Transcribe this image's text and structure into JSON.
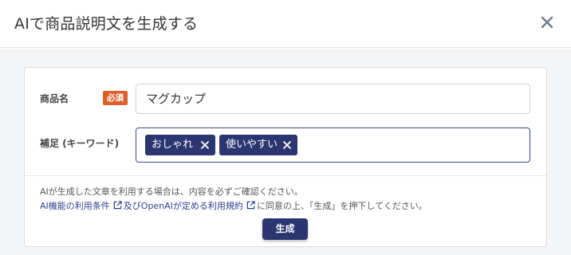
{
  "modal": {
    "title": "AIで商品説明文を生成する",
    "close_icon": "close-icon"
  },
  "form": {
    "product_name": {
      "label": "商品名",
      "required_badge": "必須",
      "value": "マグカップ"
    },
    "keywords": {
      "label": "補足 (キーワード)",
      "tags": [
        "おしゃれ",
        "使いやすい"
      ],
      "tag_remove_icon": "close-icon"
    }
  },
  "footer": {
    "notice": "AIが生成した文章を利用する場合は、内容を必ずご確認ください。",
    "terms_link1": "AI機能の利用条件",
    "terms_mid": "及びOpenAIが定める利用規約",
    "terms_end": "に同意の上、「生成」を押下してください。",
    "external_link_icon": "external-link-icon",
    "generate_label": "生成"
  },
  "colors": {
    "primary": "#2b3570",
    "badge": "#d95f2b",
    "link": "#2c3f8f"
  }
}
